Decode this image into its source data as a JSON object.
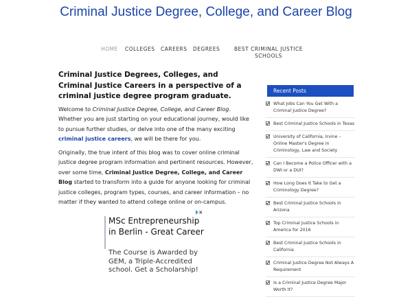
{
  "site": {
    "title": "Criminal Justice Degree, College, and Career Blog"
  },
  "nav": {
    "items": [
      {
        "label": "HOME",
        "active": true
      },
      {
        "label": "COLLEGES"
      },
      {
        "label": "CAREERS"
      },
      {
        "label": "DEGREES"
      },
      {
        "label": "BEST CRIMINAL JUSTICE SCHOOLS"
      }
    ]
  },
  "main": {
    "heading": "Criminal Justice Degrees, Colleges, and Criminal Justice Careers in a perspective of a criminal justice degree program graduate.",
    "p1": {
      "pre": "Welcome to ",
      "em": "Criminal Justice Degree, College, and Career Blog",
      "mid": ". Whether you are just starting on your educational journey, would like to pursue further studies, or delve into one of the many exciting ",
      "link": "criminal justice careers",
      "post": ", we will be there for you."
    },
    "p2": {
      "pre": "Originally, the true intent of this blog was to cover online criminal justice degree program information and pertinent resources. However, over some time, ",
      "strong": "Criminal Justice Degree, College, and Career Blog",
      "post": " started to transform into a guide for anyone looking for criminal justice colleges, program types, courses, and career information – no matter if they wanted to attend college online or on-campus."
    }
  },
  "ad": {
    "headline": "MSc Entrepreneurship in Berlin - Great Career",
    "body": "The Course is Awarded by GEM, a Triple-Accredited school. Get a Scholarship!"
  },
  "sidebar": {
    "widget_title": "Recent Posts",
    "posts": [
      "What Jobs Can You Get With a Criminal Justice Degree?",
      "Best Criminal Justice Schools in Texas",
      "University of California, Irvine – Online Master's Degree in Criminology, Law and Society",
      "Can I Become a Police Officer with a DWI or a DUI?",
      "How Long Does It Take to Get a Criminology Degree?",
      "Best Criminal Justice Schools in Arizona",
      "Top Criminal Justice Schools in America for 2016",
      "Best Criminal Justice Schools in California",
      "Criminal Justice Degree Not Always A Requirement",
      "Is a Criminal Justice Degree Major Worth It?"
    ]
  },
  "colors": {
    "brand_blue": "#1a44a8",
    "widget_bg": "#1c4fbf",
    "nav_active": "#999999"
  }
}
